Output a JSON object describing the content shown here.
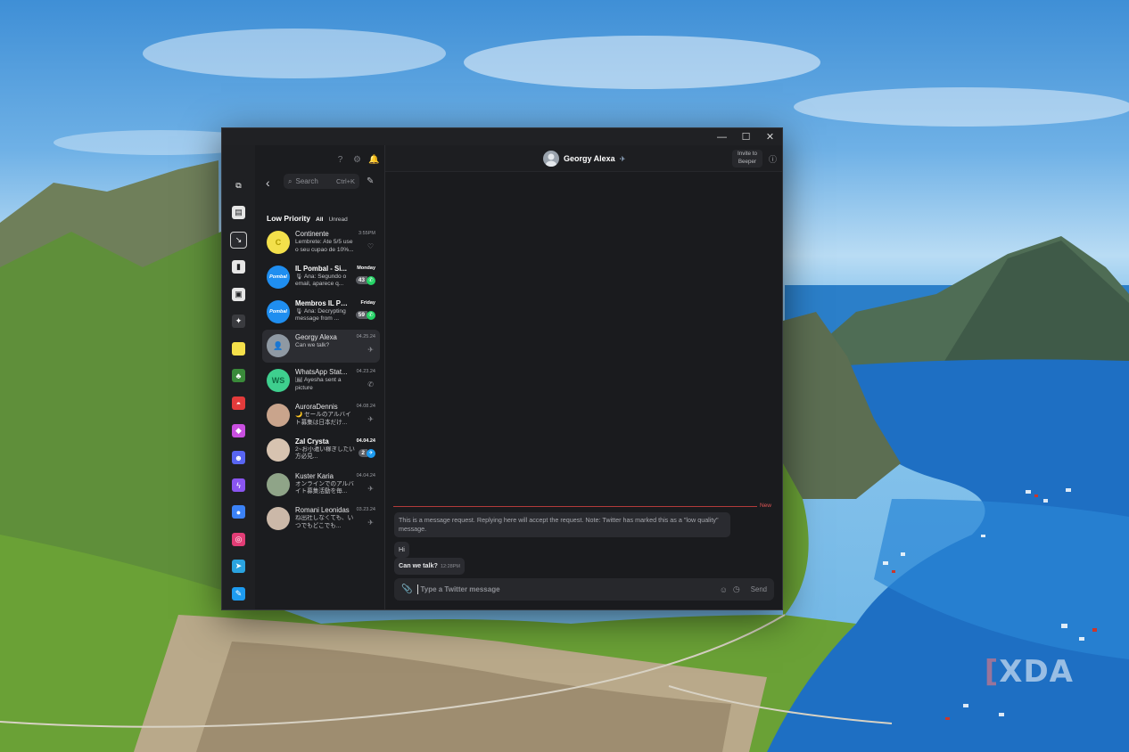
{
  "window": {
    "controls": {
      "minimize": "—",
      "maximize": "☐",
      "close": "✕"
    }
  },
  "rail": {
    "items": [
      {
        "icon": "layers-icon",
        "glyph": "⧉",
        "color": "#1f2023"
      },
      {
        "icon": "chat-bubbles-icon",
        "glyph": "▤",
        "color": "#e6e6e6"
      },
      {
        "icon": "inbox-icon",
        "glyph": "↘",
        "color": "#2a2b2f"
      },
      {
        "icon": "bookmark-icon",
        "glyph": "▮",
        "color": "#e6e6e6"
      },
      {
        "icon": "image-icon",
        "glyph": "▣",
        "color": "#e6e6e6"
      },
      {
        "icon": "avatar-space-icon",
        "glyph": "✦",
        "color": "#3a3b3f"
      },
      {
        "icon": "yellow-square-icon",
        "glyph": "",
        "color": "#f5e04a"
      },
      {
        "icon": "green-game-icon",
        "glyph": "♣",
        "color": "#3a8a3a"
      },
      {
        "icon": "pokeball-icon",
        "glyph": "◓",
        "color": "#e33b3b"
      },
      {
        "icon": "beeper-icon",
        "glyph": "◆",
        "color": "#c94fe0"
      },
      {
        "icon": "discord-icon",
        "glyph": "☻",
        "color": "#5865f2"
      },
      {
        "icon": "messenger-icon",
        "glyph": "ϟ",
        "color": "#8a55f0"
      },
      {
        "icon": "google-messages-icon",
        "glyph": "●",
        "color": "#3b82f6"
      },
      {
        "icon": "instagram-icon",
        "glyph": "◎",
        "color": "#e23d76"
      },
      {
        "icon": "telegram-icon",
        "glyph": "➤",
        "color": "#2aa3e0"
      },
      {
        "icon": "twitter-icon",
        "glyph": "✎",
        "color": "#1d9bf0"
      }
    ]
  },
  "list": {
    "top_icons": [
      "?",
      "⚙",
      "🔔"
    ],
    "back": "‹",
    "search": {
      "placeholder": "Search",
      "shortcut": "Ctrl+K"
    },
    "compose": "✎",
    "section_title": "Low Priority",
    "filters": [
      "All",
      "Unread"
    ],
    "chats": [
      {
        "name": "Continente",
        "time": "3:55PM",
        "preview": "Lembrete: Ate 5/5 use o seu cupao de 10%...",
        "avatar_text": "C",
        "avatar_color": "#f3e04b",
        "avatar_text_color": "#b09b00",
        "net": "♡",
        "bold": false
      },
      {
        "name": "IL Pombal - Si...",
        "time": "Monday",
        "preview": "🎙 Ana: Segundo o email, aparece q...",
        "avatar_text": "Pombal",
        "avatar_color": "#1f8ef0",
        "avatar_text_color": "#ffffff",
        "count": "43",
        "count_color": "#25d366",
        "net": "✆",
        "bold": true
      },
      {
        "name": "Membros IL Pom...",
        "time": "Friday",
        "preview": "🎙 Ana: Decrypting message from ...",
        "avatar_text": "Pombal",
        "avatar_color": "#1f8ef0",
        "avatar_text_color": "#ffffff",
        "count": "59",
        "count_color": "#25d366",
        "net": "✆",
        "bold": true
      },
      {
        "name": "Georgy Alexa",
        "time": "04.25.24",
        "preview": "Can we talk?",
        "avatar_text": "👤",
        "avatar_color": "#8f99a3",
        "avatar_text_color": "#dfe3e7",
        "net": "✈",
        "bold": false,
        "selected": true
      },
      {
        "name": "WhatsApp Stat...",
        "time": "04.23.24",
        "preview": "🖼 Ayesha sent a picture",
        "avatar_text": "WS",
        "avatar_color": "#3ecf8e",
        "avatar_text_color": "#0f6b43",
        "net": "✆",
        "bold": false
      },
      {
        "name": "AuroraDennis",
        "time": "04.08.24",
        "preview": "🌙 セールのアルバイト募集は日本だけ...",
        "avatar_text": "",
        "avatar_color": "#c9a48c",
        "avatar_text_color": "#ffffff",
        "net": "✈",
        "bold": false
      },
      {
        "name": "Zal Crysta",
        "time": "04.04.24",
        "preview": "2~お小遣い稼ぎしたい方必見...",
        "avatar_text": "",
        "avatar_color": "#d7c3b0",
        "avatar_text_color": "#ffffff",
        "count": "2",
        "count_color": "#1d9bf0",
        "net": "✈",
        "bold": true
      },
      {
        "name": "Kuster Karia",
        "time": "04.04.24",
        "preview": "オンラインでのアルバイト募集活動を毎...",
        "avatar_text": "",
        "avatar_color": "#8fa488",
        "avatar_text_color": "#ffffff",
        "net": "✈",
        "bold": false
      },
      {
        "name": "Romani Leonidas",
        "time": "03.23.24",
        "preview": "ね出社しなくても、いつでもどこでも...",
        "avatar_text": "",
        "avatar_color": "#cbb8a8",
        "avatar_text_color": "#ffffff",
        "net": "✈",
        "bold": false
      }
    ]
  },
  "conversation": {
    "peer_name": "Georgy Alexa",
    "peer_network_glyph": "✈",
    "invite_label": "Invite to Beeper",
    "info_glyph": "ⓘ",
    "new_label": "New",
    "notice": "This is a message request. Replying here will accept the request. Note: Twitter has marked this as a \"low quality\" message.",
    "messages": [
      {
        "text": "Hi",
        "time": ""
      },
      {
        "text": "Can we talk?",
        "time": "12:28PM"
      }
    ],
    "composer": {
      "placeholder": "Type a Twitter message",
      "send_label": "Send"
    }
  },
  "watermark": {
    "bracket": "[",
    "text": "XDA"
  }
}
